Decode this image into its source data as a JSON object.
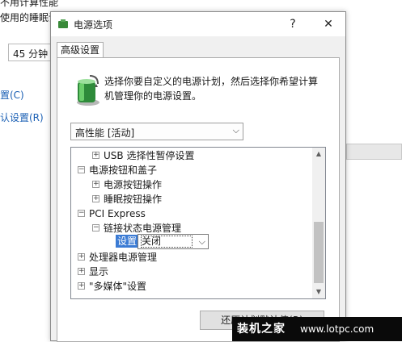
{
  "background": {
    "line1": "不用计算性能",
    "line2": "使用的睡眠设",
    "sleep_select": "45 分钟",
    "link1": "置(C)",
    "link2": "认设置(R)"
  },
  "dialog": {
    "title": "电源选项",
    "help": "?",
    "close": "✕",
    "tab": "高级设置",
    "description": "选择你要自定义的电源计划，然后选择你希望计算机管理你的电源设置。",
    "plan_select": "高性能 [活动]",
    "tree": {
      "items": [
        {
          "expander": "⊞",
          "label": "USB 选择性暂停设置"
        },
        {
          "expander": "⊟",
          "label": "电源按钮和盖子"
        },
        {
          "expander": "⊞",
          "label": "电源按钮操作"
        },
        {
          "expander": "⊞",
          "label": "睡眠按钮操作"
        },
        {
          "expander": "⊟",
          "label": "PCI Express"
        },
        {
          "expander": "⊟",
          "label": "链接状态电源管理"
        },
        {
          "expander": "⊞",
          "label": "处理器电源管理"
        },
        {
          "expander": "⊞",
          "label": "显示"
        },
        {
          "expander": "⊞",
          "label": "\"多媒体\"设置"
        }
      ],
      "setting_label": "设置:",
      "setting_value": "关闭"
    },
    "restore_button": "还原计划默认值(R)"
  },
  "watermark": {
    "brand": "装机之家",
    "url": "www.lotpc.com"
  }
}
